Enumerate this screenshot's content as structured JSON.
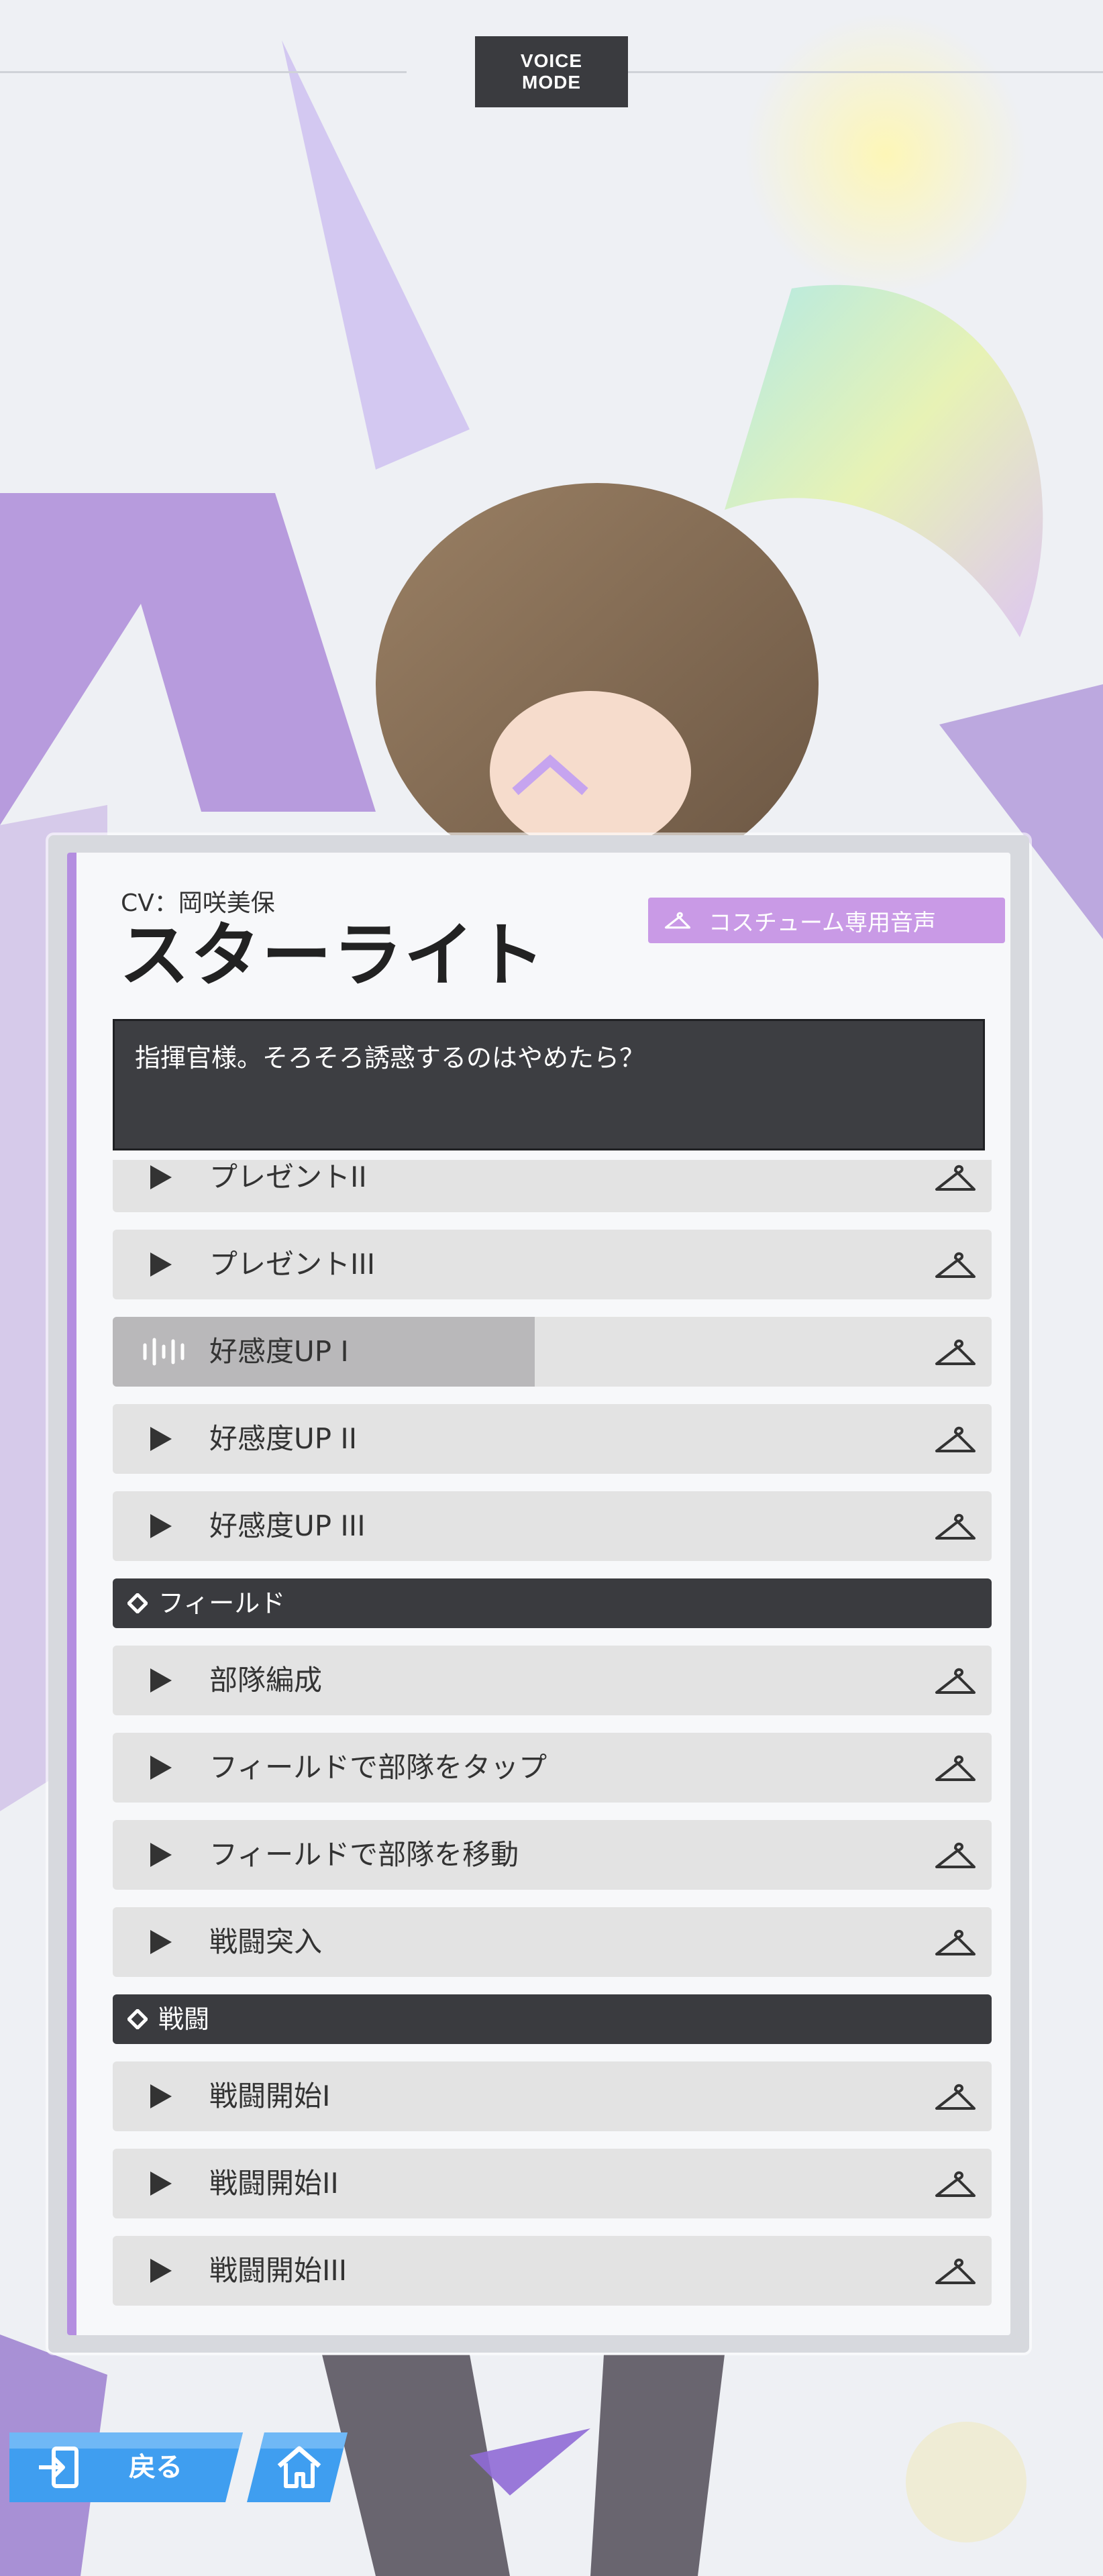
{
  "header": {
    "mode_line1": "VOICE",
    "mode_line2": "MODE"
  },
  "panel": {
    "cv": "CV：岡咲美保",
    "name": "スターライト",
    "costume_badge": "コスチューム専用音声",
    "dialog": "指揮官様。そろそろ誘惑するのはやめたら？"
  },
  "voice_list": [
    {
      "type": "voice",
      "label": "プレゼントII",
      "state": "idle"
    },
    {
      "type": "voice",
      "label": "プレゼントIII",
      "state": "idle"
    },
    {
      "type": "voice",
      "label": "好感度UP I",
      "state": "playing",
      "progress": 0.48
    },
    {
      "type": "voice",
      "label": "好感度UP II",
      "state": "idle"
    },
    {
      "type": "voice",
      "label": "好感度UP III",
      "state": "idle"
    },
    {
      "type": "section",
      "label": "フィールド"
    },
    {
      "type": "voice",
      "label": "部隊編成",
      "state": "idle"
    },
    {
      "type": "voice",
      "label": "フィールドで部隊をタップ",
      "state": "idle"
    },
    {
      "type": "voice",
      "label": "フィールドで部隊を移動",
      "state": "idle"
    },
    {
      "type": "voice",
      "label": "戦闘突入",
      "state": "idle"
    },
    {
      "type": "section",
      "label": "戦闘"
    },
    {
      "type": "voice",
      "label": "戦闘開始I",
      "state": "idle"
    },
    {
      "type": "voice",
      "label": "戦闘開始II",
      "state": "idle"
    },
    {
      "type": "voice",
      "label": "戦闘開始III",
      "state": "idle"
    }
  ],
  "footer": {
    "back_label": "戻る",
    "back_icon": "exit-icon",
    "home_icon": "home-icon"
  },
  "colors": {
    "accent": "#b48ee0",
    "badge": "#c99ae6",
    "dark": "#3a3b3f",
    "button_blue": "#3f9ef0"
  }
}
